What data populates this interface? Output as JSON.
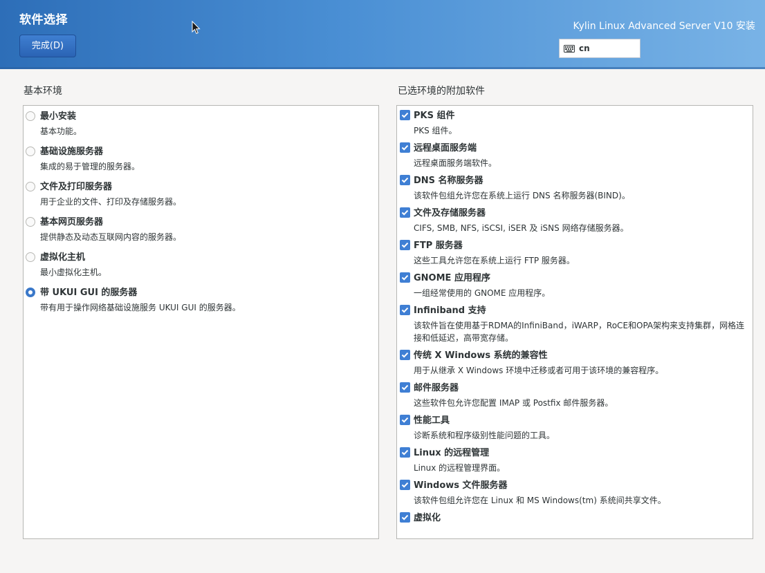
{
  "header": {
    "title": "软件选择",
    "done_label": "完成(D)",
    "product": "Kylin Linux Advanced Server V10 安装",
    "keyboard_layout": "cn"
  },
  "base_environment": {
    "label": "基本环境",
    "items": [
      {
        "title": "最小安装",
        "desc": "基本功能。",
        "selected": false
      },
      {
        "title": "基础设施服务器",
        "desc": "集成的易于管理的服务器。",
        "selected": false
      },
      {
        "title": "文件及打印服务器",
        "desc": "用于企业的文件、打印及存储服务器。",
        "selected": false
      },
      {
        "title": "基本网页服务器",
        "desc": "提供静态及动态互联网内容的服务器。",
        "selected": false
      },
      {
        "title": "虚拟化主机",
        "desc": "最小虚拟化主机。",
        "selected": false
      },
      {
        "title": "带 UKUI GUI 的服务器",
        "desc": "带有用于操作网络基础设施服务 UKUI GUI 的服务器。",
        "selected": true
      }
    ]
  },
  "addons": {
    "label": "已选环境的附加软件",
    "items": [
      {
        "title": "PKS 组件",
        "desc": "PKS 组件。",
        "checked": true
      },
      {
        "title": "远程桌面服务端",
        "desc": "远程桌面服务端软件。",
        "checked": true
      },
      {
        "title": "DNS 名称服务器",
        "desc": "该软件包组允许您在系统上运行 DNS 名称服务器(BIND)。",
        "checked": true
      },
      {
        "title": "文件及存储服务器",
        "desc": "CIFS, SMB, NFS, iSCSI, iSER 及 iSNS 网络存储服务器。",
        "checked": true
      },
      {
        "title": "FTP 服务器",
        "desc": "这些工具允许您在系统上运行 FTP 服务器。",
        "checked": true
      },
      {
        "title": "GNOME 应用程序",
        "desc": "一组经常使用的 GNOME 应用程序。",
        "checked": true
      },
      {
        "title": "Infiniband 支持",
        "desc": "该软件旨在使用基于RDMA的InfiniBand，iWARP，RoCE和OPA架构来支持集群，网格连接和低延迟，高带宽存储。",
        "checked": true
      },
      {
        "title": "传统 X Windows 系统的兼容性",
        "desc": "用于从继承 X Windows 环境中迁移或者可用于该环境的兼容程序。",
        "checked": true
      },
      {
        "title": "邮件服务器",
        "desc": "这些软件包允许您配置 IMAP 或 Postfix 邮件服务器。",
        "checked": true
      },
      {
        "title": "性能工具",
        "desc": "诊断系统和程序级别性能问题的工具。",
        "checked": true
      },
      {
        "title": "Linux 的远程管理",
        "desc": "Linux 的远程管理界面。",
        "checked": true
      },
      {
        "title": "Windows 文件服务器",
        "desc": "该软件包组允许您在 Linux 和 MS Windows(tm) 系统间共享文件。",
        "checked": true
      },
      {
        "title": "虚拟化",
        "desc": "",
        "checked": true
      }
    ]
  },
  "colors": {
    "accent": "#3f7fd4",
    "header_start": "#2d6eb8",
    "header_end": "#79b3e6"
  }
}
